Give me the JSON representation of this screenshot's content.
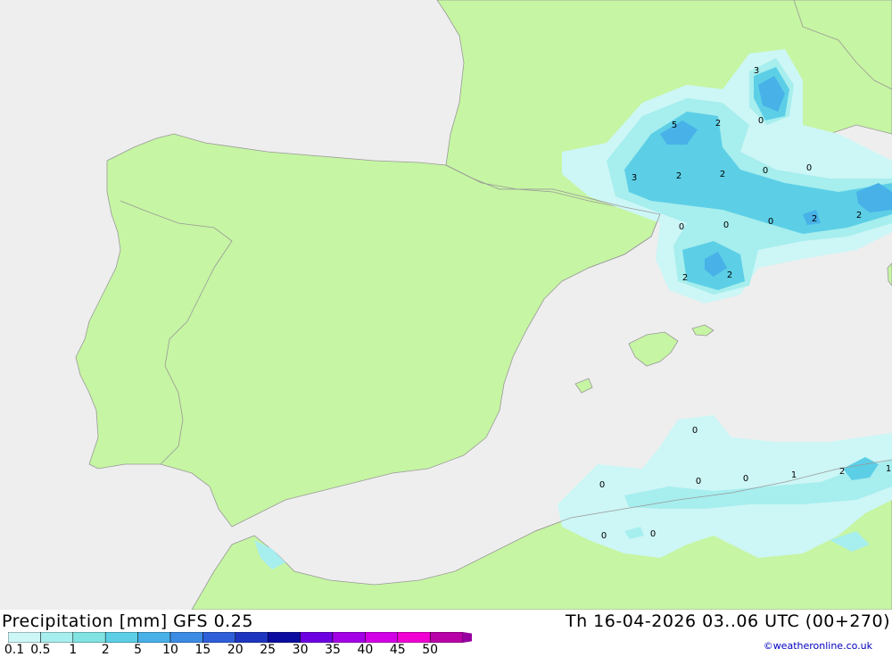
{
  "footer": {
    "title": "Precipitation [mm] GFS 0.25",
    "datetime": "Th 16-04-2026 03..06 UTC (00+270)",
    "credit": "©weatheronline.co.uk"
  },
  "legend": {
    "ticks": [
      "0.1",
      "0.5",
      "1",
      "2",
      "5",
      "10",
      "15",
      "20",
      "25",
      "30",
      "35",
      "40",
      "45",
      "50"
    ],
    "colors": [
      "#cdf6f6",
      "#a7eeee",
      "#82e3e3",
      "#5ccfe6",
      "#47b1e8",
      "#3c8be4",
      "#2e5fd8",
      "#1e35c0",
      "#0c0ca0",
      "#6c00e0",
      "#a300e6",
      "#d200e6",
      "#f000d2",
      "#b800a8",
      "#9600a0"
    ]
  },
  "map": {
    "colors": {
      "land": "#c6f5a3",
      "sea": "#eeeeee",
      "border": "#999999"
    },
    "contour_labels": [
      "3",
      "5",
      "2",
      "0",
      "3",
      "2",
      "2",
      "0",
      "0",
      "0",
      "0",
      "0",
      "2",
      "2",
      "2",
      "2",
      "0",
      "0",
      "0",
      "0",
      "1",
      "2",
      "1",
      "0",
      "0",
      "0"
    ]
  }
}
